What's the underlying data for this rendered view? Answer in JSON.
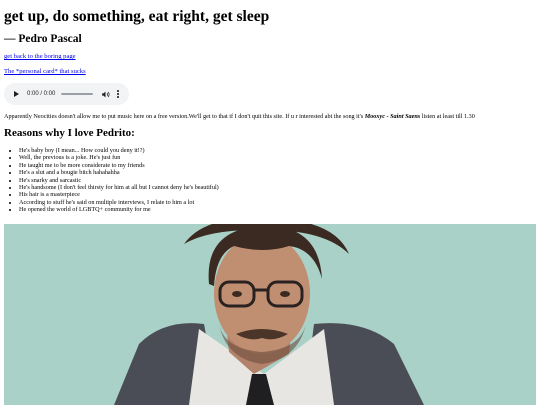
{
  "page": {
    "title": "get up, do something, eat right, get sleep",
    "author": "— Pedro Pascal",
    "links": {
      "back": "get back to the boring page",
      "personal_card": "The *personal card* that sucks"
    },
    "audio": {
      "time": "0:00 / 0:00",
      "play_icon": "play-icon",
      "volume_icon": "volume-icon",
      "menu_icon": "more-vert-icon"
    },
    "note": {
      "prefix": "Apparently Neocities doesn't allow me to put music here on a free version.We'll get to that if I don't quit this site. If u r interested abt the song it's ",
      "song": "Mooxyc - Saint Saens",
      "suffix": " listen at least till 1.30"
    },
    "reasons_heading": "Reasons why I love Pedrito:",
    "reasons": [
      "He's baby boy (I mean... How could you deny it!?)",
      "Well, the previous is a joke. He's just fun",
      "He taught me to be more considerate to my friends",
      "He's a slut and a bougie bitch hahahahha",
      "He's snarky and sarcastic",
      "He's handsome (I don't feel thirsty for him at all but I cannot deny he's beautiful)",
      "His hair is a masterpiece",
      "According to stuff he's said on multiple interviews, I relate to him a lot",
      "He opened the world of LGBTQ+ community for me"
    ],
    "photo": {
      "background_color": "#a9d1c8",
      "suit_color": "#4a4d55",
      "shirt_color": "#e8e6e2",
      "skin_color": "#c08f72",
      "hair_color": "#3a2a22"
    }
  }
}
